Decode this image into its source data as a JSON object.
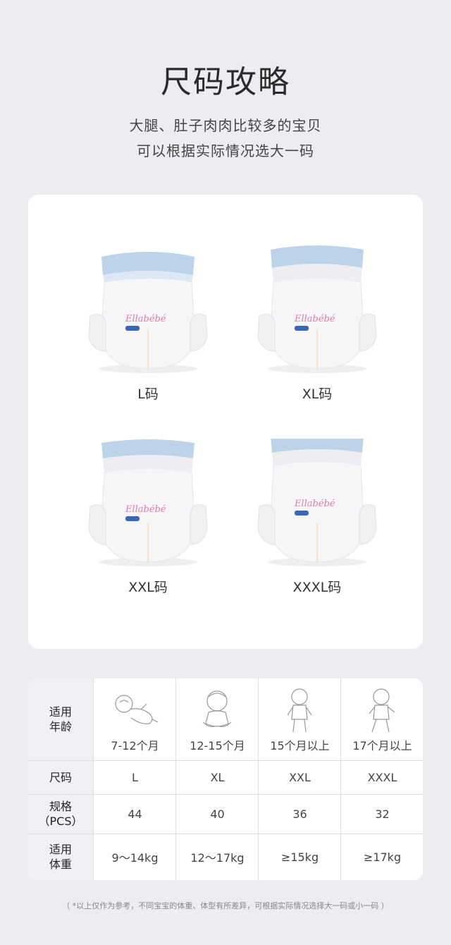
{
  "header": {
    "title": "尺码攻略",
    "subtitle_line1": "大腿、肚子肉肉比较多的宝贝",
    "subtitle_line2": "可以根据实际情况选大一码"
  },
  "products": [
    {
      "label": "L码",
      "brand": "Ellabébé",
      "size_tag": "L"
    },
    {
      "label": "XL码",
      "brand": "Ellabébé",
      "size_tag": "XL"
    },
    {
      "label": "XXL码",
      "brand": "Ellabébé",
      "size_tag": "XXL"
    },
    {
      "label": "XXXL码",
      "brand": "Ellabébé",
      "size_tag": "XXXL"
    }
  ],
  "table": {
    "row_headers": [
      "适用\n年龄",
      "尺码",
      "规格\n（PCS）",
      "适用\n体重"
    ],
    "columns": [
      {
        "age": "7-12个月",
        "size": "L",
        "pcs": "44",
        "weight": "9～14kg",
        "icon": "lying-baby-icon"
      },
      {
        "age": "12-15个月",
        "size": "XL",
        "pcs": "40",
        "weight": "12～17kg",
        "icon": "sitting-baby-icon"
      },
      {
        "age": "15个月以上",
        "size": "XXL",
        "pcs": "36",
        "weight": "≥15kg",
        "icon": "standing-baby-icon"
      },
      {
        "age": "17个月以上",
        "size": "XXXL",
        "pcs": "32",
        "weight": "≥17kg",
        "icon": "walking-baby-icon"
      }
    ]
  },
  "footnote": "（ *以上仅作为参考，不同宝宝的体重、体型有所差异，可根据实际情况选择大一码或小一码 ）",
  "colors": {
    "background": "#ececf1",
    "card": "#ffffff",
    "waistband": "#bcd3ea",
    "brand_pink": "#e07aa6",
    "brand_blue": "#3a66b5"
  }
}
